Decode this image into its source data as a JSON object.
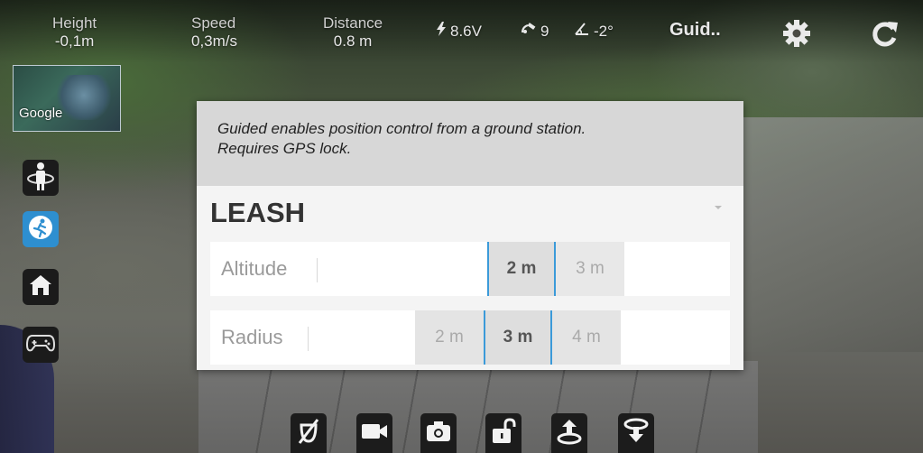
{
  "telemetry": {
    "height": {
      "label": "Height",
      "value": "-0,1m"
    },
    "speed": {
      "label": "Speed",
      "value": "0,3m/s"
    },
    "distance": {
      "label": "Distance",
      "value": "0.8 m"
    },
    "battery": "8.6V",
    "satellites": "9",
    "tilt": "-2°",
    "mode": "Guid.."
  },
  "map": {
    "watermark": "Google"
  },
  "dialog": {
    "description_line1": "Guided enables position control from a ground station.",
    "description_line2": "Requires GPS lock.",
    "title": "LEASH",
    "altitude": {
      "label": "Altitude",
      "options": [
        "2 m",
        "3 m"
      ],
      "selected": "2 m"
    },
    "radius": {
      "label": "Radius",
      "options": [
        "2 m",
        "3 m",
        "4 m"
      ],
      "selected": "3 m"
    }
  },
  "icons": {
    "top": [
      "battery-bolt-icon",
      "satellite-icon",
      "tilt-angle-icon",
      "settings-gear-icon",
      "refresh-icon"
    ],
    "left": [
      "orbit-person-icon",
      "follow-me-icon",
      "home-icon",
      "gamepad-icon"
    ],
    "bottom": [
      "gimbal-off-icon",
      "video-camera-icon",
      "photo-camera-icon",
      "unlock-icon",
      "takeoff-icon",
      "land-icon"
    ]
  },
  "colors": {
    "accent": "#3b9ad9",
    "active_button": "#2e8fd0"
  }
}
